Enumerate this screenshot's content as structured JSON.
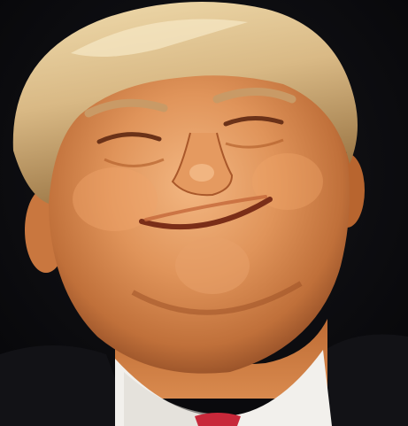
{
  "photo": {
    "colors": {
      "background": "#0a0a0c",
      "hair_light": "#e3c99a",
      "hair_shadow": "#b08a55",
      "skin_highlight": "#f0b07a",
      "skin_mid": "#d98a4e",
      "skin_shadow": "#a55a2e",
      "collar": "#f2f0ec",
      "tie": "#c8283a",
      "jacket": "#141418"
    }
  }
}
